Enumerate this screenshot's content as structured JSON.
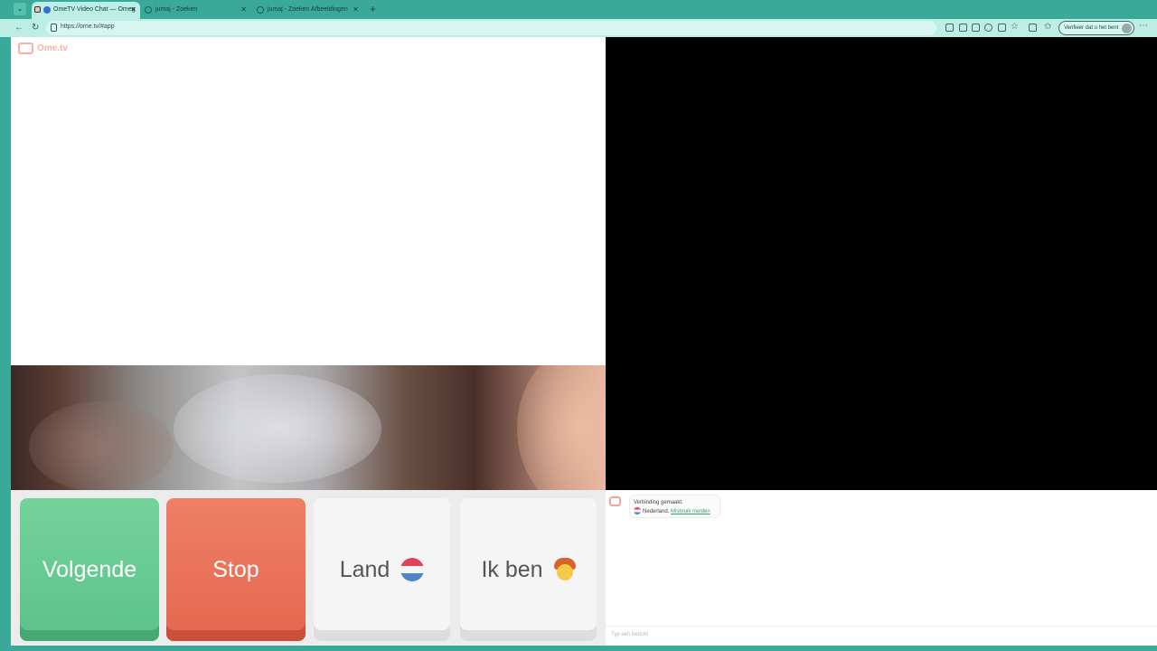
{
  "browser": {
    "tabs": [
      {
        "title": "OmeTV Video Chat — Omeg",
        "active": true
      },
      {
        "title": "jumaj - Zoeken",
        "active": false
      },
      {
        "title": "jumaj - Zoeken Afbeeldingen",
        "active": false
      }
    ],
    "url": "https://ome.tv/#app",
    "verify_label": "Verifieer dat u het bent"
  },
  "app": {
    "logo_text": "Ome.tv"
  },
  "controls": {
    "next_label": "Volgende",
    "stop_label": "Stop",
    "country_label": "Land",
    "i_am_label": "Ik ben"
  },
  "chat": {
    "status": "Verbinding gemaakt.",
    "country": "Nederland.",
    "report_link": "Misbruik melden",
    "input_placeholder": "Typ een bericht"
  },
  "colors": {
    "accent": "#3aa99a",
    "next": "#5cc28a",
    "stop": "#e4674f"
  }
}
